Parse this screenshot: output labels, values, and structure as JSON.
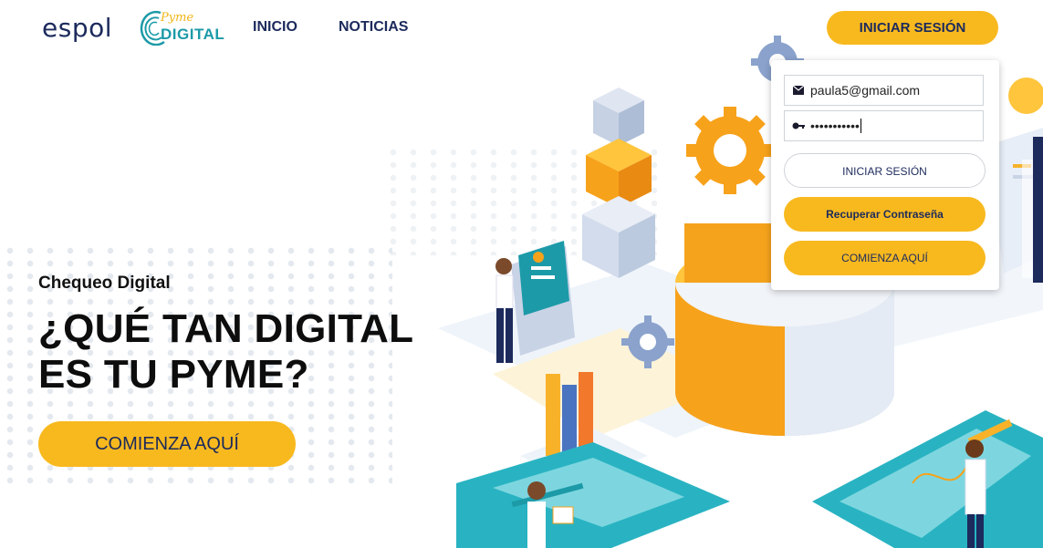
{
  "header": {
    "logo_espol": "espol",
    "logo_pyme_script": "Pyme",
    "logo_pyme_digital": "DIGITAL",
    "nav": [
      "INICIO",
      "NOTICIAS"
    ],
    "login_button": "INICIAR SESIÓN"
  },
  "hero": {
    "subtitle": "Chequeo Digital",
    "title_line1": "¿QUÉ TAN DIGITAL",
    "title_line2": "ES TU PYME?",
    "cta": "COMIENZA AQUÍ"
  },
  "login_panel": {
    "email_value": "paula5@gmail.com",
    "password_value": "•••••••••••",
    "login_button": "INICIAR SESIÓN",
    "recover_button": "Recuperar Contraseña",
    "start_button": "COMIENZA AQUÍ"
  },
  "colors": {
    "accent": "#f8b91f",
    "navy": "#1c2a5c",
    "teal": "#1c9aa8"
  },
  "icons": [
    "envelope-icon",
    "key-icon",
    "gear-icon"
  ]
}
